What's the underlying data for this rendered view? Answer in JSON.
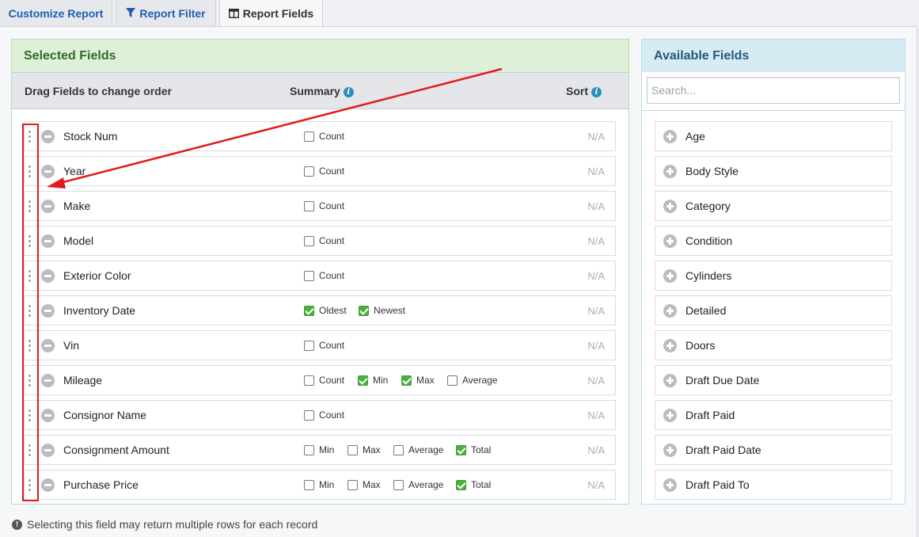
{
  "tabs": [
    {
      "label": "Customize Report",
      "icon": ""
    },
    {
      "label": "Report Filter",
      "icon": "filter-icon"
    },
    {
      "label": "Report Fields",
      "icon": "columns-icon"
    }
  ],
  "selected_panel": {
    "title": "Selected Fields",
    "col_drag": "Drag Fields to change order",
    "col_summary": "Summary",
    "col_sort": "Sort",
    "info_glyph": "i",
    "rows": [
      {
        "name": "Stock Num",
        "options": [
          {
            "label": "Count",
            "checked": false
          }
        ],
        "sort": "N/A"
      },
      {
        "name": "Year",
        "options": [
          {
            "label": "Count",
            "checked": false
          }
        ],
        "sort": "N/A"
      },
      {
        "name": "Make",
        "options": [
          {
            "label": "Count",
            "checked": false
          }
        ],
        "sort": "N/A"
      },
      {
        "name": "Model",
        "options": [
          {
            "label": "Count",
            "checked": false
          }
        ],
        "sort": "N/A"
      },
      {
        "name": "Exterior Color",
        "options": [
          {
            "label": "Count",
            "checked": false
          }
        ],
        "sort": "N/A"
      },
      {
        "name": "Inventory Date",
        "options": [
          {
            "label": "Oldest",
            "checked": true
          },
          {
            "label": "Newest",
            "checked": true
          }
        ],
        "sort": "N/A"
      },
      {
        "name": "Vin",
        "options": [
          {
            "label": "Count",
            "checked": false
          }
        ],
        "sort": "N/A"
      },
      {
        "name": "Mileage",
        "options": [
          {
            "label": "Count",
            "checked": false
          },
          {
            "label": "Min",
            "checked": true
          },
          {
            "label": "Max",
            "checked": true
          },
          {
            "label": "Average",
            "checked": false
          }
        ],
        "sort": "N/A"
      },
      {
        "name": "Consignor Name",
        "options": [
          {
            "label": "Count",
            "checked": false
          }
        ],
        "sort": "N/A"
      },
      {
        "name": "Consignment Amount",
        "options": [
          {
            "label": "Min",
            "checked": false
          },
          {
            "label": "Max",
            "checked": false
          },
          {
            "label": "Average",
            "checked": false
          },
          {
            "label": "Total",
            "checked": true
          }
        ],
        "sort": "N/A"
      },
      {
        "name": "Purchase Price",
        "options": [
          {
            "label": "Min",
            "checked": false
          },
          {
            "label": "Max",
            "checked": false
          },
          {
            "label": "Average",
            "checked": false
          },
          {
            "label": "Total",
            "checked": true
          }
        ],
        "sort": "N/A"
      }
    ]
  },
  "available_panel": {
    "title": "Available Fields",
    "search_placeholder": "Search...",
    "fields": [
      "Age",
      "Body Style",
      "Category",
      "Condition",
      "Cylinders",
      "Detailed",
      "Doors",
      "Draft Due Date",
      "Draft Paid",
      "Draft Paid Date",
      "Draft Paid To"
    ]
  },
  "footnote": {
    "icon": "!",
    "text": "Selecting this field may return multiple rows for each record"
  },
  "colors": {
    "accent_link": "#1f5fb3",
    "selected_header_bg": "#dff0d8",
    "available_header_bg": "#d7ebf5",
    "checkbox_checked": "#4caf3e",
    "annotation_red": "#e31b1b"
  }
}
